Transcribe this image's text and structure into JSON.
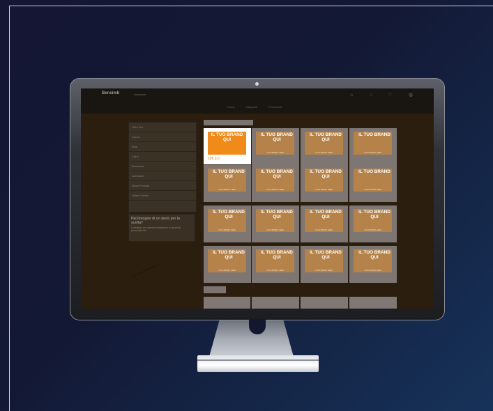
{
  "site": {
    "logo": "Bensimb",
    "breadcrumb": "› Accessori",
    "icons": [
      "home-icon",
      "user-icon",
      "wishlist-icon",
      "cart-icon"
    ],
    "subnav": [
      "Home",
      "Categorie",
      "Promozioni"
    ]
  },
  "sidebar": {
    "header": "Filtra Per",
    "search_placeholder": "Cerca...",
    "items": [
      {
        "label": "Blue",
        "expanded": false
      },
      {
        "label": "Zaino",
        "expanded": false
      },
      {
        "label": "Borraccia",
        "expanded": false
      },
      {
        "label": "Accessori",
        "expanded": false
      },
      {
        "label": "Nuovi Prodotti",
        "expanded": false
      },
      {
        "label": "Ultime Uscite",
        "expanded": false
      }
    ]
  },
  "promo": {
    "title": "Hai bisogno di un aiuto per la scelta?",
    "text": "Contattaci per ricevere assistenza sui prodotti personalizzati."
  },
  "products": [
    {
      "title": "IL TUO BRAND QUI",
      "subtitle": "",
      "price": "22€ 3,0",
      "selected": true
    },
    {
      "title": "IL TUO BRAND QUI",
      "subtitle": "YOUR BRAND HERE",
      "price": ""
    },
    {
      "title": "IL TUO BRAND QUI",
      "subtitle": "YOUR BRAND HERE",
      "price": ""
    },
    {
      "title": "IL TUO BRAND",
      "subtitle": "YOUR BRAND HERE",
      "price": ""
    },
    {
      "title": "IL TUO BRAND QUI",
      "subtitle": "YOUR BRAND HERE",
      "price": ""
    },
    {
      "title": "IL TUO BRAND QUI",
      "subtitle": "YOUR BRAND HERE",
      "price": ""
    },
    {
      "title": "IL TUO BRAND QUI",
      "subtitle": "YOUR BRAND HERE",
      "price": ""
    },
    {
      "title": "IL TUO BRAND",
      "subtitle": "YOUR BRAND HERE",
      "price": ""
    },
    {
      "title": "IL TUO BRAND QUI",
      "subtitle": "YOUR BRAND HERE",
      "price": ""
    },
    {
      "title": "IL TUO BRAND QUI",
      "subtitle": "YOUR BRAND HERE",
      "price": ""
    },
    {
      "title": "IL TUO BRAND QUI",
      "subtitle": "YOUR BRAND HERE",
      "price": ""
    },
    {
      "title": "IL TUO BRAND QUI",
      "subtitle": "YOUR BRAND HERE",
      "price": ""
    },
    {
      "title": "IL TUO BRAND QUI",
      "subtitle": "YOUR BRAND HERE",
      "price": ""
    },
    {
      "title": "IL TUO BRAND QUI",
      "subtitle": "YOUR BRAND HERE",
      "price": ""
    },
    {
      "title": "IL TUO BRAND QUI",
      "subtitle": "YOUR BRAND HERE",
      "price": ""
    },
    {
      "title": "IL TUO BRAND QUI",
      "subtitle": "YOUR BRAND HERE",
      "price": ""
    }
  ],
  "colors": {
    "accent": "#f08a18",
    "card": "#b5834a",
    "background": "#151633"
  }
}
